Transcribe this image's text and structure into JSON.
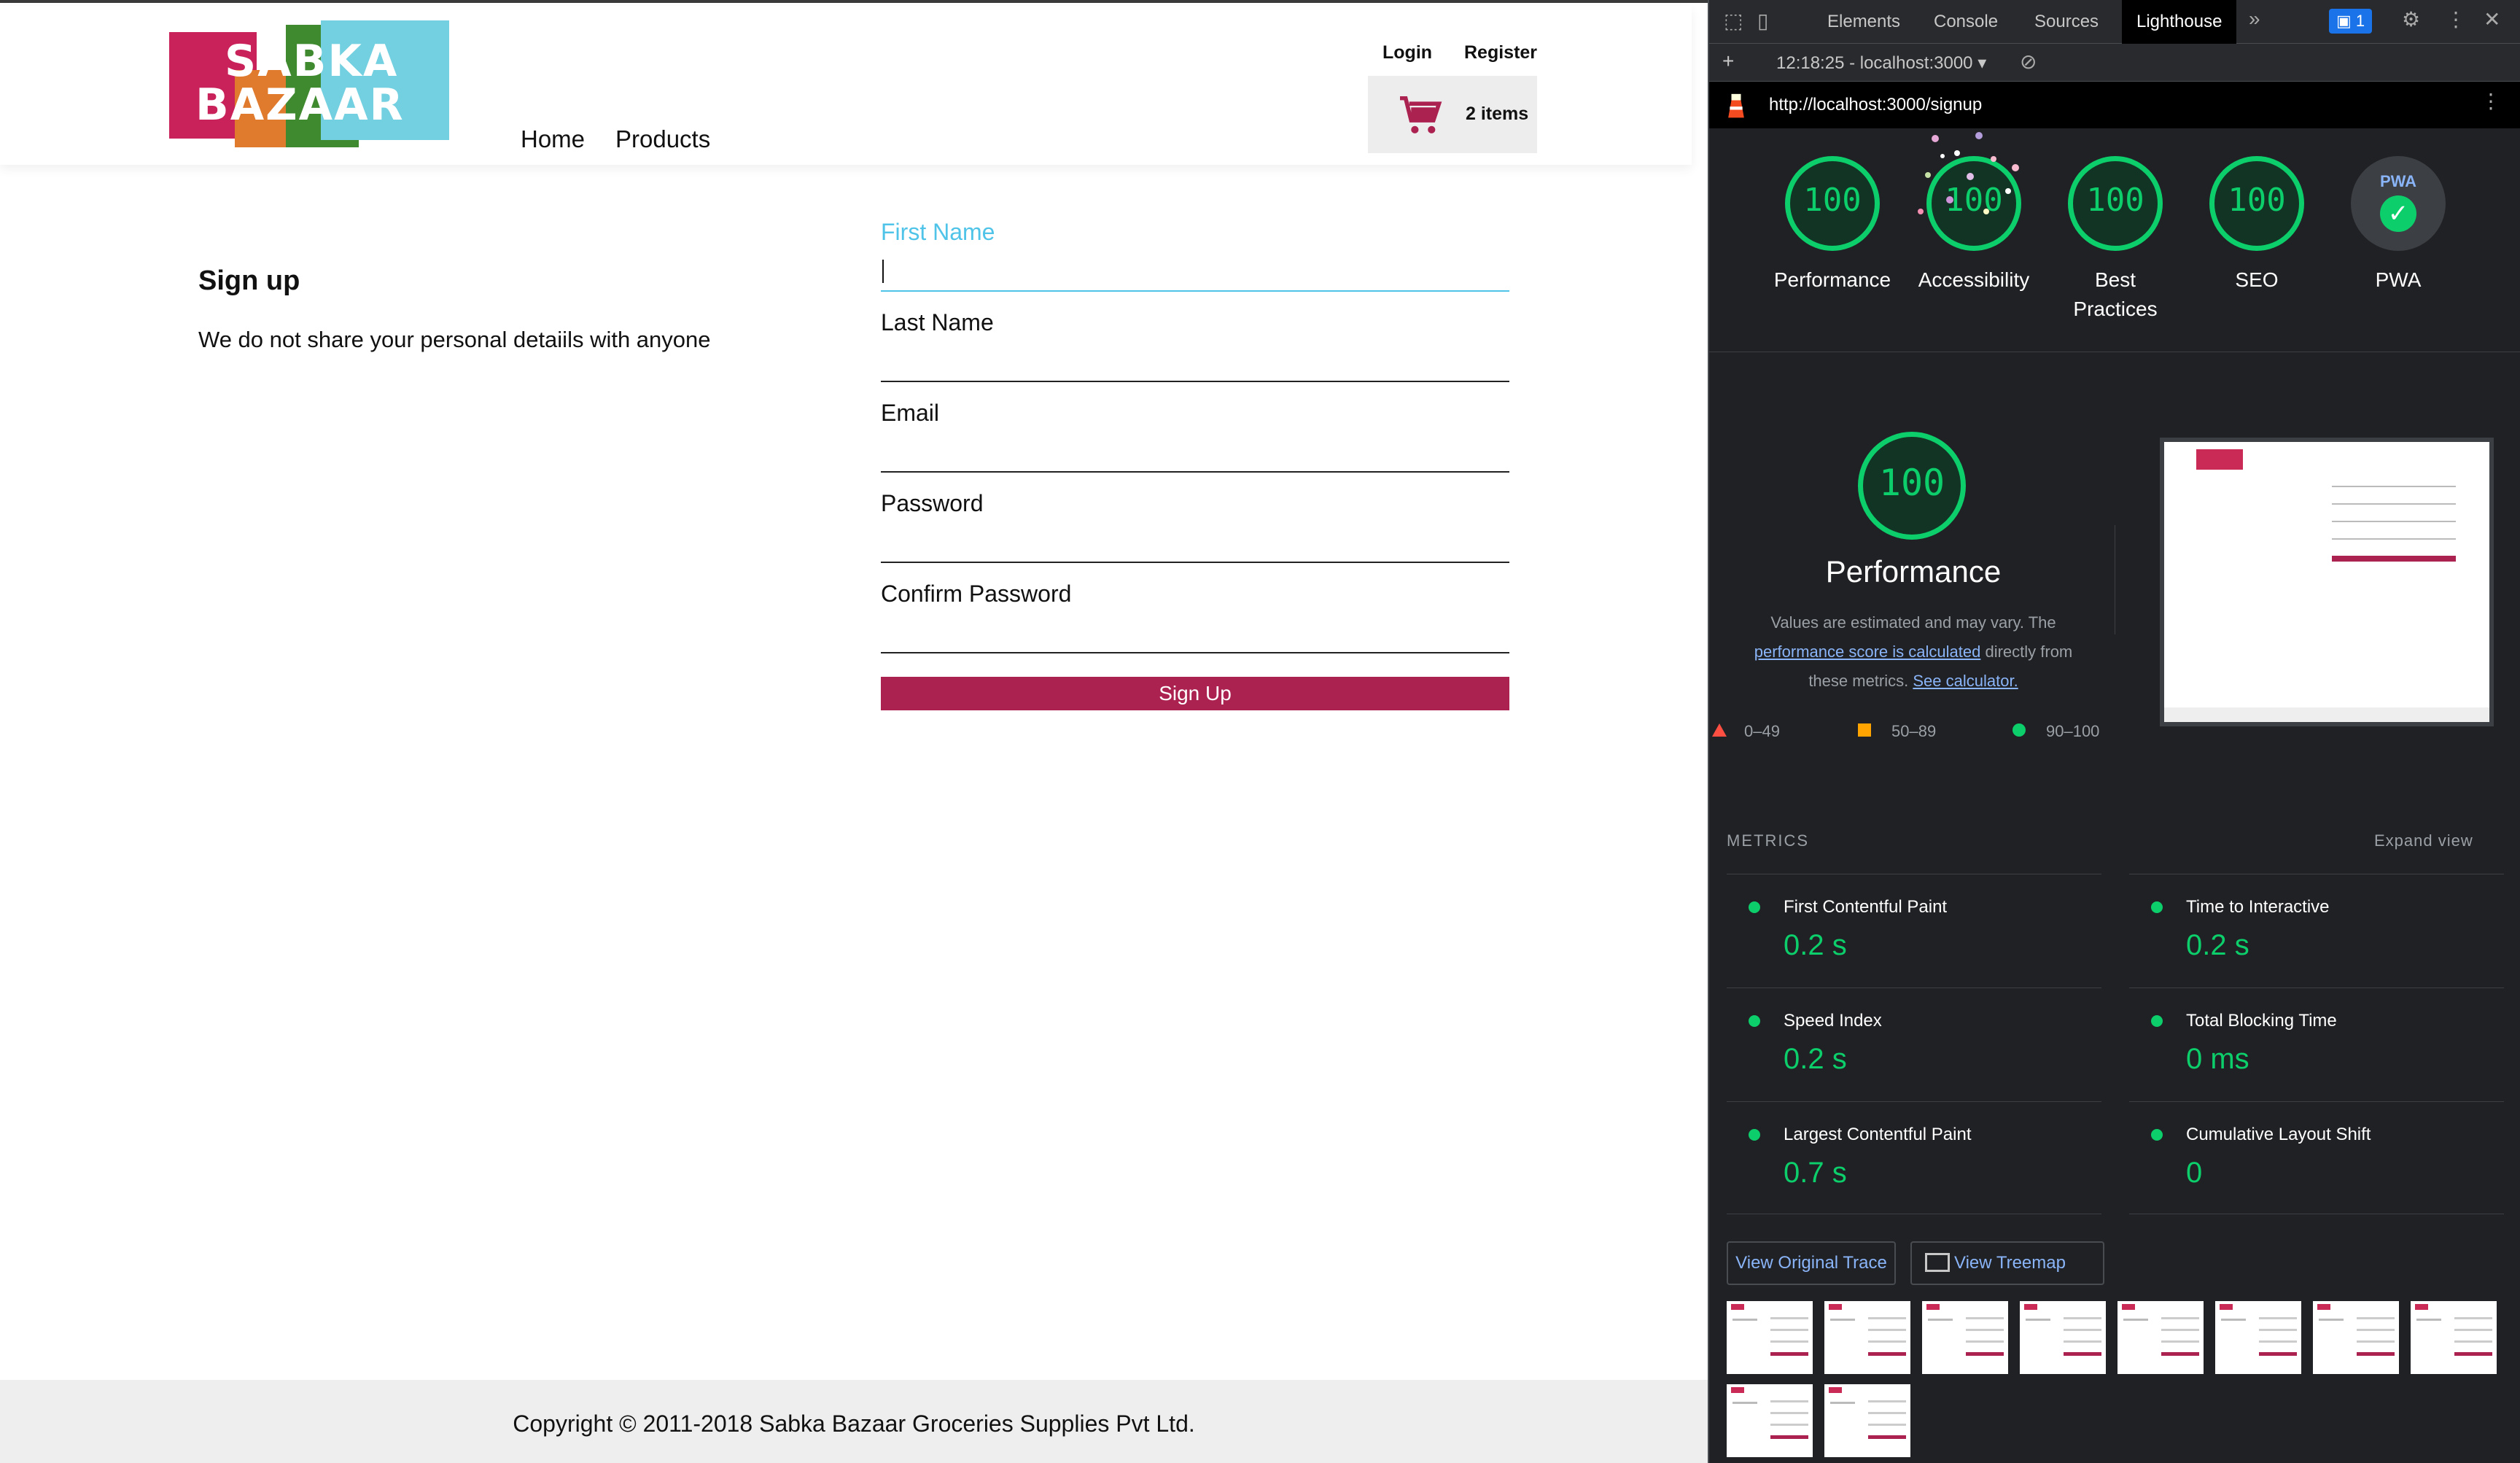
{
  "app": {
    "logo": {
      "line1": "SABKA",
      "line2": "BAZAAR"
    },
    "nav": {
      "home": "Home",
      "products": "Products"
    },
    "top_links": {
      "login": "Login",
      "register": "Register"
    },
    "cart": {
      "count_label": "2 items"
    },
    "signup": {
      "title": "Sign up",
      "description": "We do not share your personal detaiils with anyone",
      "fields": {
        "first_name": "First Name",
        "last_name": "Last Name",
        "email": "Email",
        "password": "Password",
        "confirm_password": "Confirm Password"
      },
      "button": "Sign Up"
    },
    "footer": "Copyright © 2011-2018 Sabka Bazaar Groceries Supplies Pvt Ltd.",
    "colors": {
      "brand": "#ab2150",
      "focus": "#4fc3e8"
    }
  },
  "devtools": {
    "tabs": {
      "elements": "Elements",
      "console": "Console",
      "sources": "Sources",
      "lighthouse": "Lighthouse"
    },
    "issues_count": "1",
    "report_selector": "12:18:25 - localhost:3000",
    "url": "http://localhost:3000/signup",
    "scores": {
      "performance": {
        "value": "100",
        "label": "Performance"
      },
      "accessibility": {
        "value": "100",
        "label": "Accessibility"
      },
      "best_practices": {
        "value": "100",
        "label_line1": "Best",
        "label_line2": "Practices"
      },
      "seo": {
        "value": "100",
        "label": "SEO"
      },
      "pwa": {
        "badge": "PWA",
        "label": "PWA"
      }
    },
    "perf_section": {
      "score": "100",
      "title": "Performance",
      "desc_part1": "Values are estimated and may vary. The",
      "desc_link1": "performance score is calculated",
      "desc_part2": "directly from",
      "desc_part3": "these metrics.",
      "desc_link2": "See calculator.",
      "legend": {
        "fail": "0–49",
        "average": "50–89",
        "pass": "90–100"
      }
    },
    "metrics": {
      "heading": "METRICS",
      "expand": "Expand view",
      "fcp": {
        "name": "First Contentful Paint",
        "value": "0.2 s"
      },
      "tti": {
        "name": "Time to Interactive",
        "value": "0.2 s"
      },
      "si": {
        "name": "Speed Index",
        "value": "0.2 s"
      },
      "tbt": {
        "name": "Total Blocking Time",
        "value": "0 ms"
      },
      "lcp": {
        "name": "Largest Contentful Paint",
        "value": "0.7 s"
      },
      "cls": {
        "name": "Cumulative Layout Shift",
        "value": "0"
      }
    },
    "buttons": {
      "trace": "View Original Trace",
      "treemap": "View Treemap"
    },
    "colors": {
      "pass": "#0cce6b",
      "average": "#ffa400",
      "fail": "#ff4e42",
      "link": "#8ab4f8"
    }
  }
}
